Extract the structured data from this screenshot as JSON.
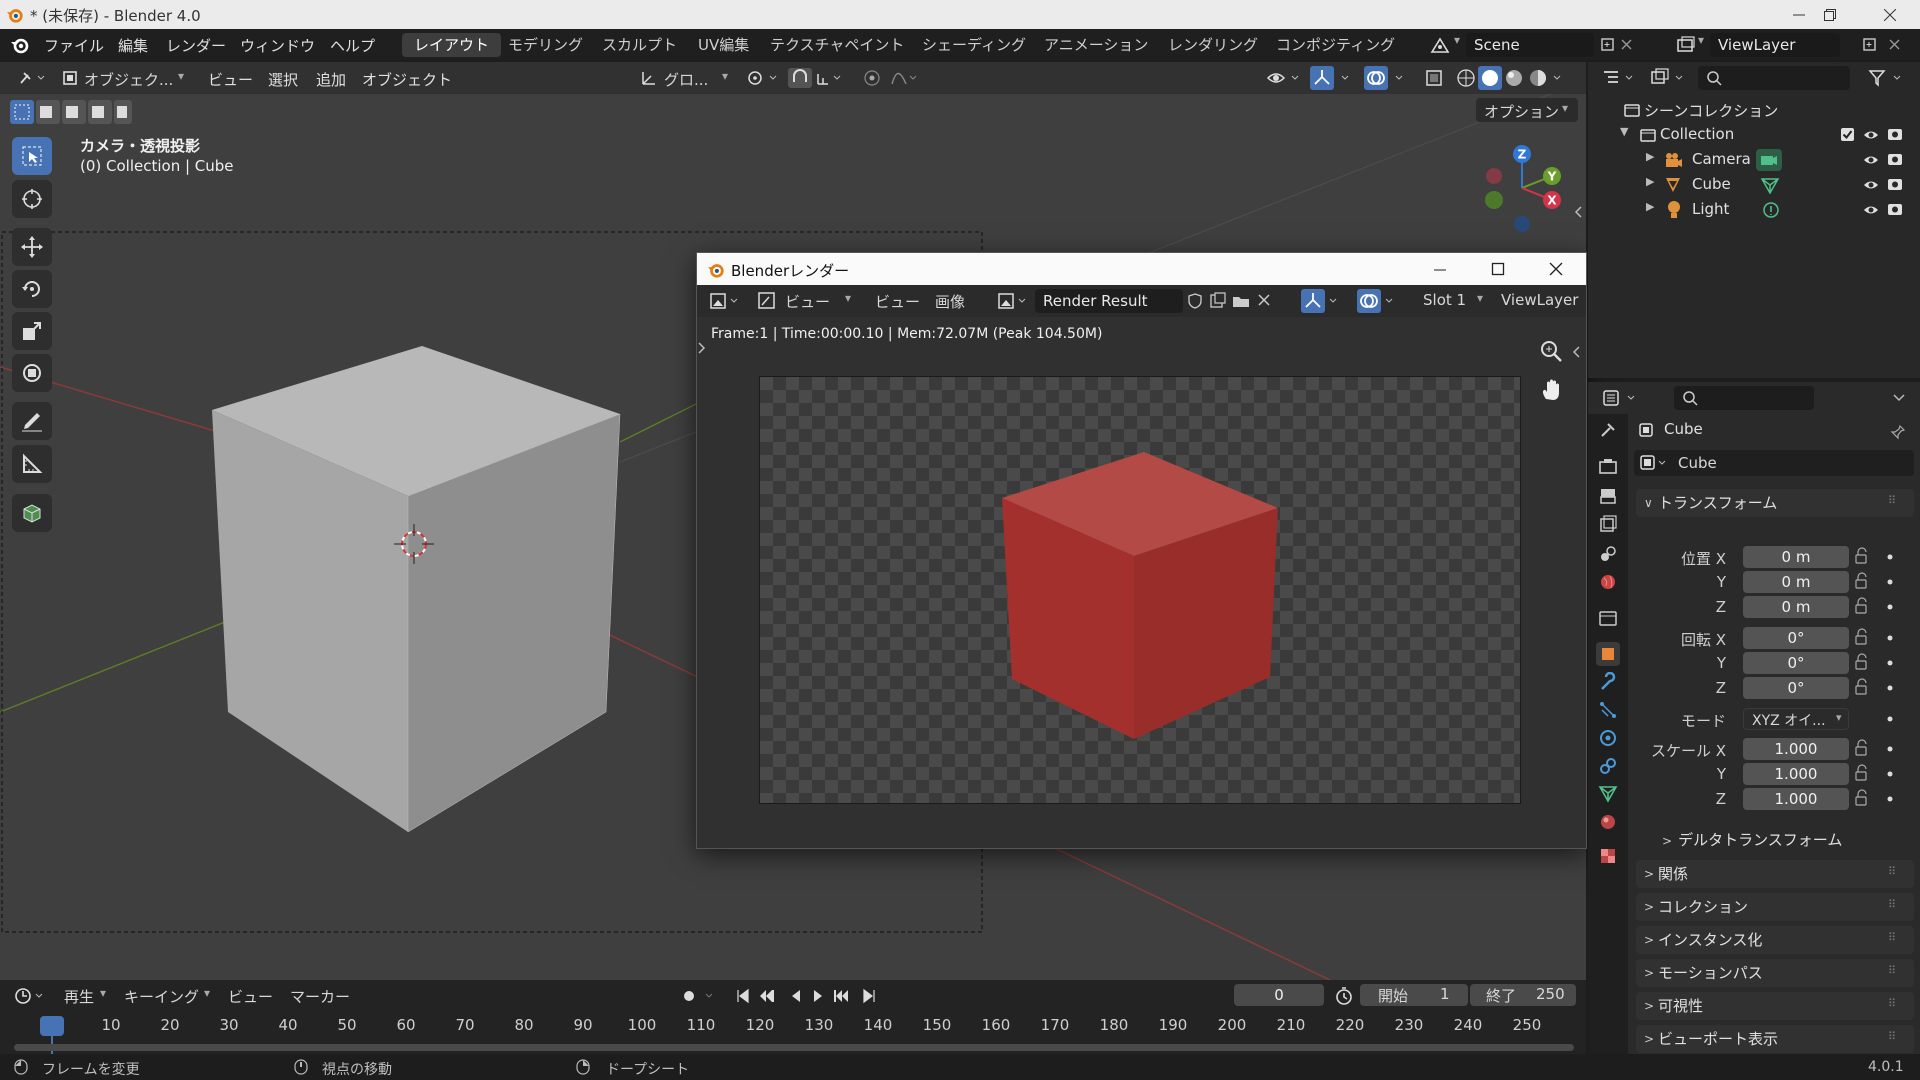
{
  "window": {
    "title": "* (未保存) - Blender 4.0"
  },
  "menu": [
    "ファイル",
    "編集",
    "レンダー",
    "ウィンドウ",
    "ヘルプ"
  ],
  "workspaces": [
    {
      "label": "レイアウト",
      "active": true
    },
    {
      "label": "モデリング"
    },
    {
      "label": "スカルプト"
    },
    {
      "label": "UV編集"
    },
    {
      "label": "テクスチャペイント"
    },
    {
      "label": "シェーディング"
    },
    {
      "label": "アニメーション"
    },
    {
      "label": "レンダリング"
    },
    {
      "label": "コンポジティング"
    }
  ],
  "scene": {
    "name": "Scene"
  },
  "viewlayer": {
    "name": "ViewLayer"
  },
  "viewport": {
    "mode": "オブジェク...",
    "menus": [
      "ビュー",
      "選択",
      "追加",
      "オブジェクト"
    ],
    "transform_orientation": "グロ...",
    "options": "オプション",
    "overlay_line1": "カメラ・透視投影",
    "overlay_line2": "(0) Collection | Cube",
    "gizmo": {
      "x": "X",
      "y": "Y",
      "z": "Z"
    }
  },
  "render_window": {
    "title": "Blenderレンダー",
    "view_menu": "ビュー",
    "view_menu2": "ビュー",
    "image_menu": "画像",
    "image_name": "Render Result",
    "slot": "Slot 1",
    "viewlayer": "ViewLayer",
    "stats": "Frame:1 | Time:00:00.10 | Mem:72.07M (Peak 104.50M)"
  },
  "outliner": {
    "root": "シーンコレクション",
    "collection": "Collection",
    "items": [
      {
        "label": "Camera",
        "color": "#e0913b"
      },
      {
        "label": "Cube",
        "color": "#e0913b"
      },
      {
        "label": "Light",
        "color": "#e0913b"
      }
    ]
  },
  "properties": {
    "object_name": "Cube",
    "data_name": "Cube",
    "transform_header": "トランスフォーム",
    "location_label": "位置 X",
    "location": [
      "0 m",
      "0 m",
      "0 m"
    ],
    "rotation_label": "回転 X",
    "rotation": [
      "0°",
      "0°",
      "0°"
    ],
    "mode_label": "モード",
    "mode_value": "XYZ オイ...",
    "scale_label": "スケール X",
    "scale": [
      "1.000",
      "1.000",
      "1.000"
    ],
    "axis_y": "Y",
    "axis_z": "Z",
    "delta": "デルタトランスフォーム",
    "panels": [
      "関係",
      "コレクション",
      "インスタンス化",
      "モーションパス",
      "可視性",
      "ビューポート表示"
    ]
  },
  "timeline": {
    "menus": [
      "再生",
      "キーイング",
      "ビュー",
      "マーカー"
    ],
    "current_frame": "0",
    "start_label": "開始",
    "start_value": "1",
    "end_label": "終了",
    "end_value": "250",
    "ticks": [
      "0",
      "10",
      "20",
      "30",
      "40",
      "50",
      "60",
      "70",
      "80",
      "90",
      "100",
      "110",
      "120",
      "130",
      "140",
      "150",
      "160",
      "170",
      "180",
      "190",
      "200",
      "210",
      "220",
      "230",
      "240",
      "250"
    ]
  },
  "statusbar": {
    "left": "フレームを変更",
    "mid": "視点の移動",
    "right": "ドープシート",
    "version": "4.0.1"
  },
  "colors": {
    "accent": "#4772b3",
    "render_cube": "#b5322f",
    "viewport_cube": "#9a9a9a"
  }
}
